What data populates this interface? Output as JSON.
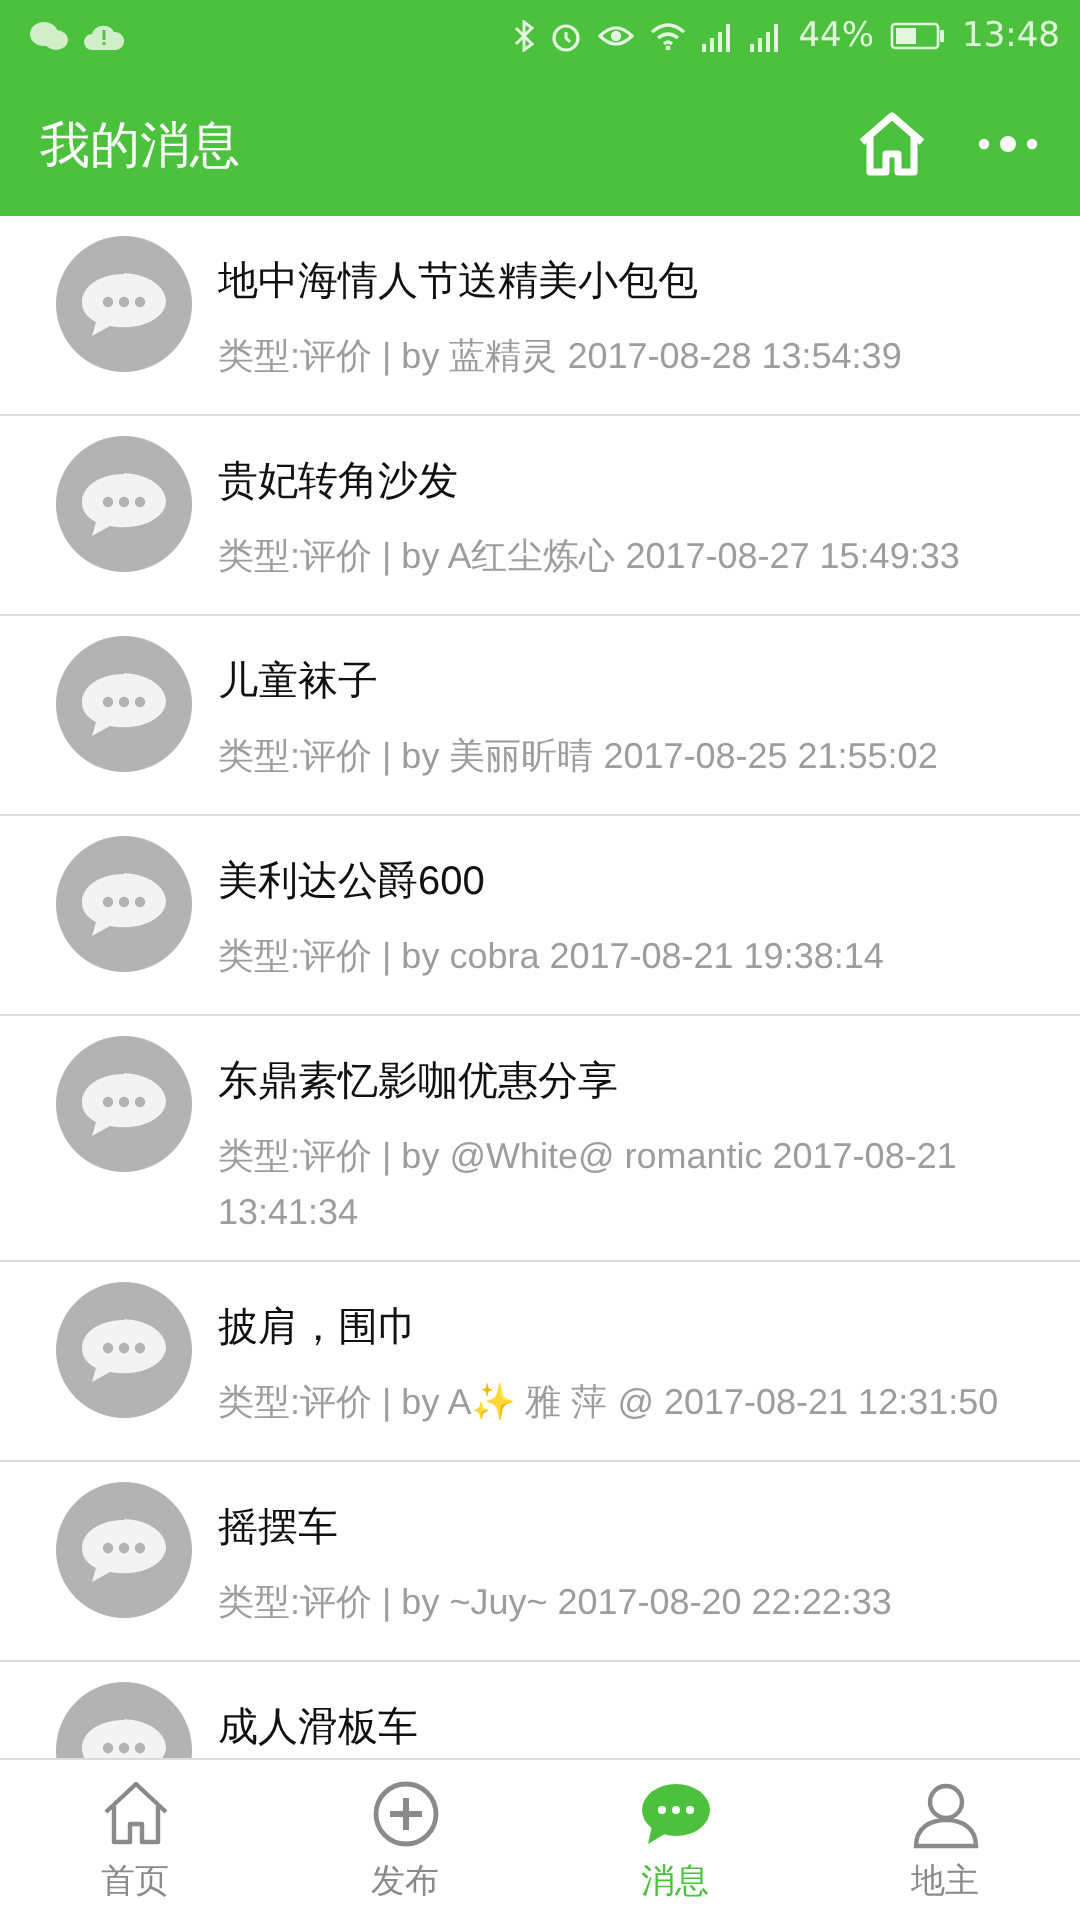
{
  "status_bar": {
    "battery": "44%",
    "time": "13:48"
  },
  "header": {
    "title": "我的消息"
  },
  "messages": [
    {
      "title": "地中海情人节送精美小包包",
      "meta": "类型:评价 | by 蓝精灵 2017-08-28 13:54:39"
    },
    {
      "title": "贵妃转角沙发",
      "meta": "类型:评价 | by A红尘炼心 2017-08-27 15:49:33"
    },
    {
      "title": "儿童袜子",
      "meta": "类型:评价 | by 美丽昕晴 2017-08-25 21:55:02"
    },
    {
      "title": "美利达公爵600",
      "meta": "类型:评价 | by cobra 2017-08-21 19:38:14"
    },
    {
      "title": "东鼎素忆影咖优惠分享",
      "meta": "类型:评价 | by @White@ romantic 2017-08-21 13:41:34"
    },
    {
      "title": "披肩，围巾",
      "meta": "类型:评价 | by A✨ 雅 萍 @ 2017-08-21 12:31:50"
    },
    {
      "title": "摇摆车",
      "meta": "类型:评价 | by ~Juy~ 2017-08-20 22:22:33"
    },
    {
      "title": "成人滑板车"
    }
  ],
  "tabs": [
    {
      "label": "首页",
      "kind": "home",
      "selected": false
    },
    {
      "label": "发布",
      "kind": "add",
      "selected": false
    },
    {
      "label": "消息",
      "kind": "message",
      "selected": true
    },
    {
      "label": "地主",
      "kind": "user",
      "selected": false
    }
  ]
}
